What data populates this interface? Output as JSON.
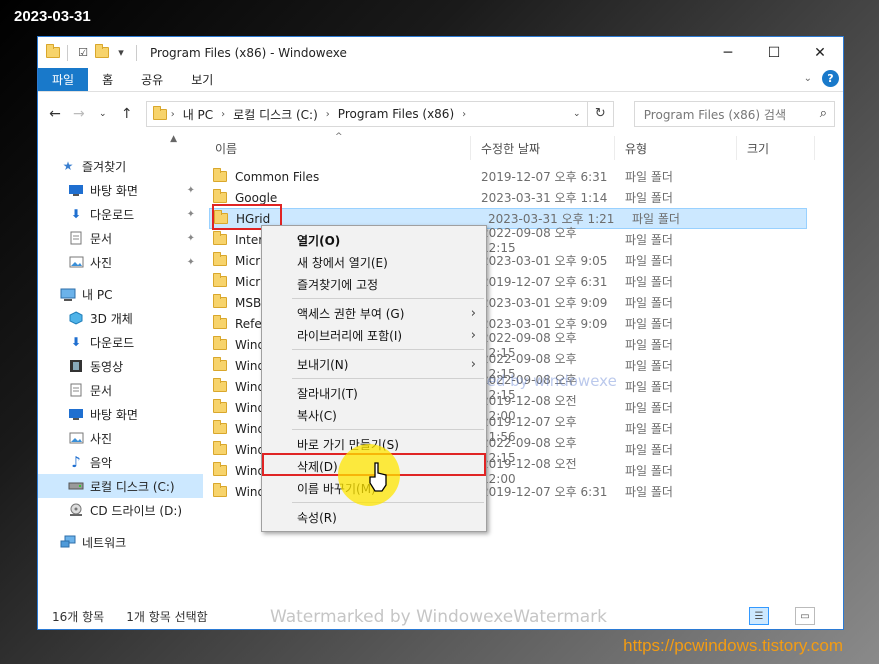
{
  "overlay": {
    "date": "2023-03-31",
    "url": "https://pcwindows.tistory.com",
    "watermark_inner": "watermarked by windowexe",
    "watermark_bottom": "Watermarked by WindowexeWatermark"
  },
  "titlebar": {
    "title": "Program Files (x86)   - Windowexe",
    "minimize": "─",
    "maximize": "☐",
    "close": "✕"
  },
  "ribbon": {
    "tabs": [
      "파일",
      "홈",
      "공유",
      "보기"
    ],
    "expand": "⌄",
    "help": "?"
  },
  "address": {
    "crumbs": [
      "내 PC",
      "로컬 디스크 (C:)",
      "Program Files (x86)"
    ],
    "search_placeholder": "Program Files (x86) 검색"
  },
  "nav": {
    "quick_access": "즐겨찾기",
    "quick_items": [
      "바탕 화면",
      "다운로드",
      "문서",
      "사진"
    ],
    "this_pc": "내 PC",
    "pc_items": [
      "3D 개체",
      "다운로드",
      "동영상",
      "문서",
      "바탕 화면",
      "사진",
      "음악",
      "로컬 디스크 (C:)",
      "CD 드라이브 (D:)"
    ],
    "network": "네트워크"
  },
  "columns": {
    "name": "이름",
    "date": "수정한 날짜",
    "type": "유형",
    "size": "크기"
  },
  "files": [
    {
      "name": "Common Files",
      "date": "2019-12-07 오후 6:31",
      "type": "파일 폴더"
    },
    {
      "name": "Google",
      "date": "2023-03-31 오후 1:14",
      "type": "파일 폴더"
    },
    {
      "name": "HGrid",
      "date": "2023-03-31 오후 1:21",
      "type": "파일 폴더"
    },
    {
      "name": "Inter",
      "date": "2022-09-08 오후 12:15",
      "type": "파일 폴더"
    },
    {
      "name": "Micr",
      "date": "2023-03-01 오후 9:05",
      "type": "파일 폴더"
    },
    {
      "name": "Micr",
      "date": "2019-12-07 오후 6:31",
      "type": "파일 폴더"
    },
    {
      "name": "MSB",
      "date": "2023-03-01 오후 9:09",
      "type": "파일 폴더"
    },
    {
      "name": "Refer",
      "date": "2023-03-01 오후 9:09",
      "type": "파일 폴더"
    },
    {
      "name": "Wind",
      "date": "2022-09-08 오후 12:15",
      "type": "파일 폴더"
    },
    {
      "name": "Wind",
      "date": "2022-09-08 오후 12:15",
      "type": "파일 폴더"
    },
    {
      "name": "Wind",
      "date": "2022-09-08 오후 12:15",
      "type": "파일 폴더"
    },
    {
      "name": "Wind",
      "date": "2019-12-08 오전 12:00",
      "type": "파일 폴더"
    },
    {
      "name": "Wind",
      "date": "2019-12-07 오후 11:56",
      "type": "파일 폴더"
    },
    {
      "name": "Wind",
      "date": "2022-09-08 오후 12:15",
      "type": "파일 폴더"
    },
    {
      "name": "Wind",
      "date": "2019-12-08 오전 12:00",
      "type": "파일 폴더"
    },
    {
      "name": "Wind",
      "date": "2019-12-07 오후 6:31",
      "type": "파일 폴더"
    }
  ],
  "context_menu": {
    "open": "열기(O)",
    "open_new_window": "새 창에서 열기(E)",
    "pin_quick": "즐겨찾기에 고정",
    "access": "액세스 권한 부여 (G)",
    "library": "라이브러리에 포함(I)",
    "send_to": "보내기(N)",
    "cut": "잘라내기(T)",
    "copy": "복사(C)",
    "shortcut": "바로 가기 만들기(S)",
    "delete": "삭제(D)",
    "rename": "이름 바꾸기(M)",
    "properties": "속성(R)"
  },
  "status": {
    "count": "16개 항목",
    "selected": "1개 항목 선택함"
  }
}
